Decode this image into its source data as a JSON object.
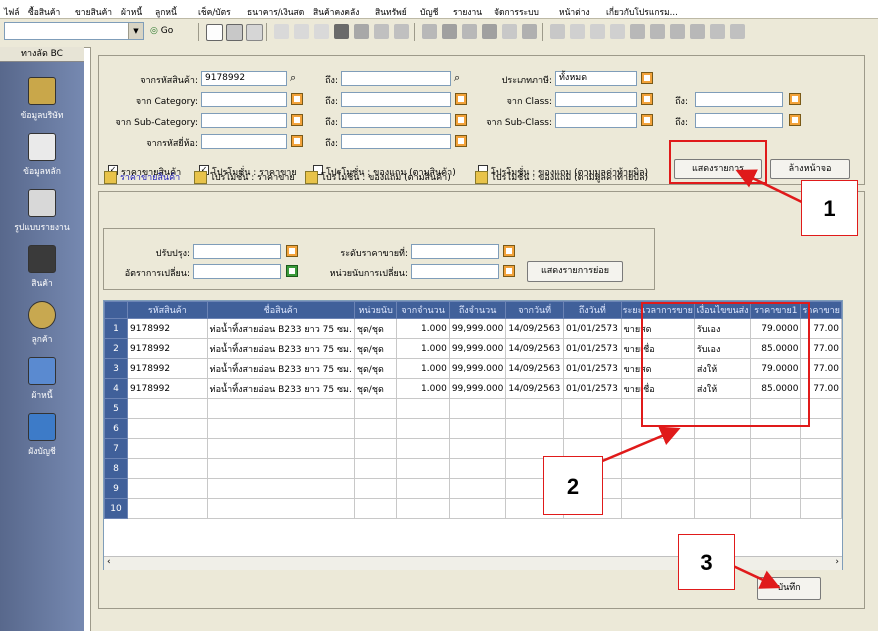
{
  "menu": [
    "ไฟล์",
    "ซื้อสินค้า",
    "ขายสินค้า",
    "ผ้าหนี้",
    "ลูกหนี้",
    "เช็ค/บัตร",
    "ธนาคาร/เงินสด",
    "สินค้าคงคลัง",
    "สินทรัพย์",
    "บัญชี",
    "รายงาน",
    "จัดการระบบ",
    "หน้าต่าง",
    "เกี่ยวกับโปรแกรม..."
  ],
  "toolbar": {
    "go_label": "Go"
  },
  "sidebar": {
    "title": "ทางลัด BC",
    "items": [
      "ข้อมูลบริษัท",
      "ข้อมูลหลัก",
      "รูปแบบรายงาน",
      "สินค้า",
      "ลูกค้า",
      "ผ้าหนี้",
      "ผังบัญชี"
    ]
  },
  "filters": {
    "from_code_label": "จากรหัสสินค้า:",
    "from_code_value": "9178992",
    "to_label": "ถึง:",
    "from_category_label": "จาก Category:",
    "from_subcategory_label": "จาก Sub-Category:",
    "from_brand_label": "จากรหัสยี่ห้อ:",
    "tax_type_label": "ประเภทภาษี:",
    "tax_type_value": "ทั้งหมด",
    "from_class_label": "จาก Class:",
    "from_subclass_label": "จาก Sub-Class:",
    "checks": [
      {
        "label": "ราคาขายสินค้า",
        "checked": true
      },
      {
        "label": "โปรโมชั่น : ราคาขาย",
        "checked": true
      },
      {
        "label": "โปรโมชั่น : ของแถม (ตามสินค้า)",
        "checked": false
      },
      {
        "label": "โปรโมชั่น : ของแถม (ตามมูลค่าท้ายบิล)",
        "checked": false
      }
    ],
    "show_button": "แสดงรายการ",
    "clear_button": "ล้างหน้าจอ"
  },
  "tabs": [
    "ราคาขายสินค้า",
    "โปรโมชั่น : ราคาขาย",
    "โปรโมชั่น : ของแถม (ตามสินค้า)",
    "โปรโมชั่น : ของแถม (ตามมูลค่าท้ายบิล)"
  ],
  "subpanel": {
    "adjust_label": "ปรับปรุง:",
    "rate_label": "อัตราการเปลี่ยน:",
    "price_level_label": "ระดับราคาขายที่:",
    "unit_change_label": "หน่วยนับการเปลี่ยน:",
    "show_sub_button": "แสดงรายการย่อย"
  },
  "grid": {
    "columns": [
      "รหัสสินค้า",
      "ชื่อสินค้า",
      "หน่วยนับ",
      "จากจำนวน",
      "ถึงจำนวน",
      "จากวันที่",
      "ถึงวันที่",
      "ระยะเวลาการขาย",
      "เงื่อนไขขนส่ง",
      "ราคาขาย1",
      "ราคาขาย"
    ],
    "row_numbers": [
      "1",
      "2",
      "3",
      "4",
      "5",
      "6",
      "7",
      "8",
      "9",
      "10"
    ],
    "rows": [
      [
        "9178992",
        "ท่อน้ำทิ้งสายอ่อน B233 ยาว 75 ซม.",
        "ชุด/ชุด",
        "1.000",
        "99,999.000",
        "14/09/2563",
        "01/01/2573",
        "ขายสด",
        "รับเอง",
        "79.0000",
        "77.00"
      ],
      [
        "9178992",
        "ท่อน้ำทิ้งสายอ่อน B233 ยาว 75 ซม.",
        "ชุด/ชุด",
        "1.000",
        "99,999.000",
        "14/09/2563",
        "01/01/2573",
        "ขายเชื่อ",
        "รับเอง",
        "85.0000",
        "77.00"
      ],
      [
        "9178992",
        "ท่อน้ำทิ้งสายอ่อน B233 ยาว 75 ซม.",
        "ชุด/ชุด",
        "1.000",
        "99,999.000",
        "14/09/2563",
        "01/01/2573",
        "ขายสด",
        "ส่งให้",
        "79.0000",
        "77.00"
      ],
      [
        "9178992",
        "ท่อน้ำทิ้งสายอ่อน B233 ยาว 75 ซม.",
        "ชุด/ชุด",
        "1.000",
        "99,999.000",
        "14/09/2563",
        "01/01/2573",
        "ขายเชื่อ",
        "ส่งให้",
        "85.0000",
        "77.00"
      ]
    ]
  },
  "save_button": "บันทึก",
  "callouts": [
    "1",
    "2",
    "3"
  ]
}
